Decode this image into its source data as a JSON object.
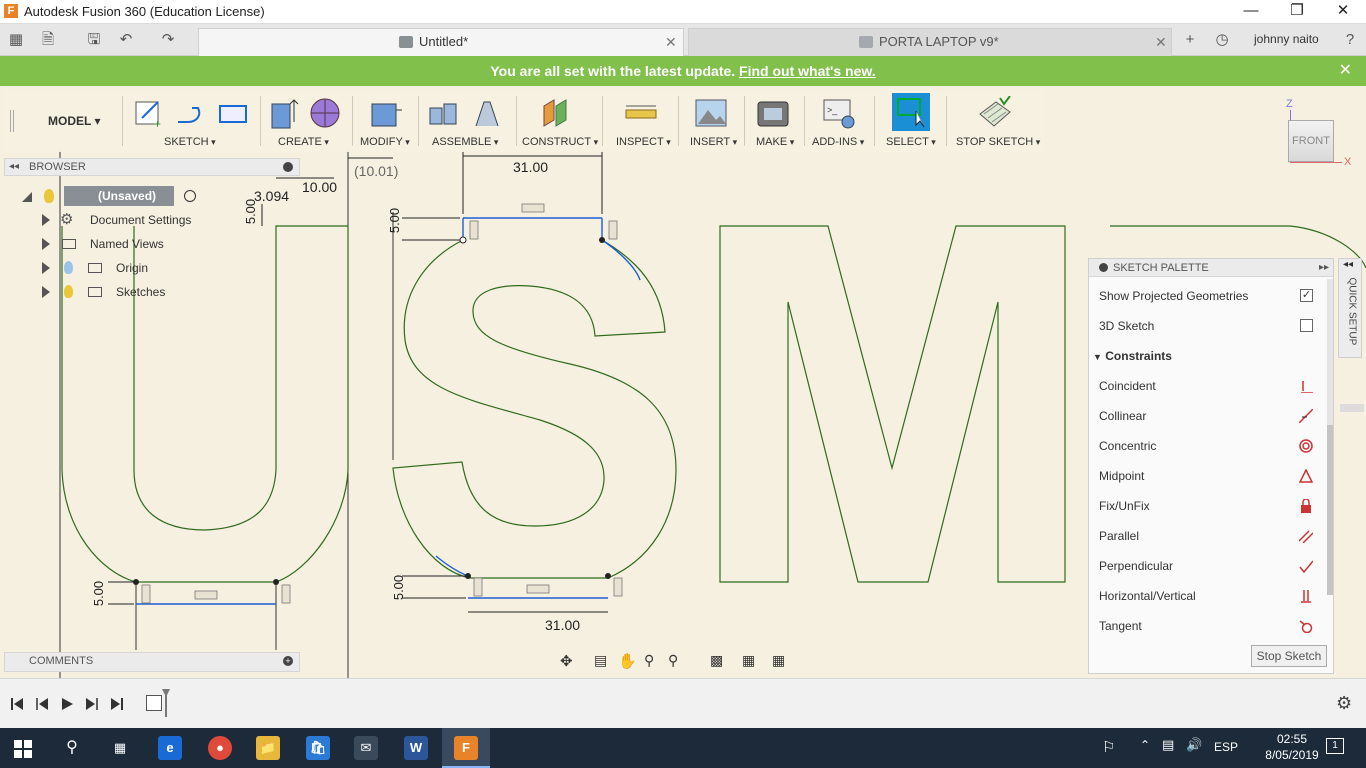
{
  "window": {
    "title": "Autodesk Fusion 360 (Education License)",
    "logo": "F"
  },
  "tabs": [
    {
      "label": "Untitled*",
      "active": true
    },
    {
      "label": "PORTA LAPTOP v9*",
      "active": false
    }
  ],
  "user": {
    "name": "johnny naito"
  },
  "update_bar": {
    "message": "You are all set with the latest update.",
    "link": "Find out what's new."
  },
  "toolbar": {
    "workspace": "MODEL",
    "groups": [
      "SKETCH",
      "CREATE",
      "MODIFY",
      "ASSEMBLE",
      "CONSTRUCT",
      "INSPECT",
      "INSERT",
      "MAKE",
      "ADD-INS",
      "SELECT",
      "STOP SKETCH"
    ]
  },
  "browser": {
    "title": "BROWSER",
    "root": "(Unsaved)",
    "items": [
      "Document Settings",
      "Named Views",
      "Origin",
      "Sketches"
    ]
  },
  "comments": {
    "title": "COMMENTS"
  },
  "palette": {
    "title": "SKETCH PALETTE",
    "show_projected": "Show Projected Geometries",
    "sketch3d": "3D Sketch",
    "constraints_header": "Constraints",
    "constraints": [
      "Coincident",
      "Collinear",
      "Concentric",
      "Midpoint",
      "Fix/UnFix",
      "Parallel",
      "Perpendicular",
      "Horizontal/Vertical",
      "Tangent"
    ],
    "stop_button": "Stop Sketch",
    "quick_setup": "QUICK SETUP"
  },
  "viewcube": {
    "face": "FRONT",
    "axis_z": "Z",
    "axis_x": "X"
  },
  "dimensions": {
    "d1": "31.00",
    "d2": "31.00",
    "d3": "5.00",
    "d4": "5.00",
    "d5": "5.00",
    "d6": "10.00",
    "d7": "(10.01)",
    "d8": "3.094",
    "d9": "5.00"
  },
  "taskbar": {
    "lang": "ESP",
    "time": "02:55",
    "date": "8/05/2019",
    "notif": "1"
  },
  "colors": {
    "update_green": "#81c14b",
    "sketch_line": "#2f6b1c",
    "constraint_blue": "#1b5fd6",
    "select_blue": "#1a8fd6"
  }
}
